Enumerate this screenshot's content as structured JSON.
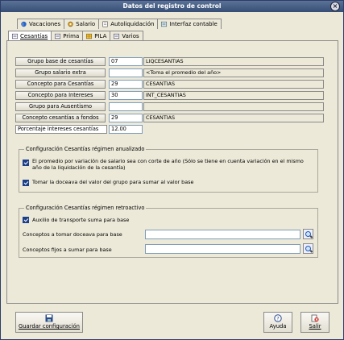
{
  "window": {
    "title": "Datos del registro de control"
  },
  "tabs_row1": [
    {
      "label": "Vacaciones",
      "icon": "vacation-icon",
      "underline": "V"
    },
    {
      "label": "Salario",
      "icon": "gear-icon",
      "underline": "S"
    },
    {
      "label": "Autoliquidación",
      "icon": "document-icon",
      "underline": "A"
    },
    {
      "label": "Interfaz contable",
      "icon": "ledger-icon",
      "underline": ""
    }
  ],
  "tabs_row2": [
    {
      "label": "Cesantías",
      "icon": "list-icon",
      "active": true
    },
    {
      "label": "Prima",
      "icon": "list-icon"
    },
    {
      "label": "PILA",
      "icon": "grid-icon"
    },
    {
      "label": "Varios",
      "icon": "list-icon"
    }
  ],
  "fields": [
    {
      "label": "Grupo base de cesantías",
      "code": "07",
      "desc": "LIQCESANTIAS"
    },
    {
      "label": "Grupo salario extra",
      "code": "",
      "desc": "<Toma el promedio del año>"
    },
    {
      "label": "Concepto para Cesantías",
      "code": "29",
      "desc": "CESANTIAS"
    },
    {
      "label": "Concepto para Intereses",
      "code": "30",
      "desc": "INT_CESANTIAS"
    },
    {
      "label": "Grupo para Ausentismo",
      "code": "",
      "desc": ""
    },
    {
      "label": "Concepto cesantías a fondos",
      "code": "29",
      "desc": "CESANTIAS"
    },
    {
      "label": "Porcentaje intereses cesantías",
      "code": "12.00",
      "desc": null
    }
  ],
  "group_anual": {
    "title": "Configuración Cesantías régimen anualizado",
    "opt1": "El promedio por variación de salario sea con corte de año (Sólo se tiene en cuenta variación en el mismo año de la liquidación de la cesantía)",
    "opt2": "Tomar la doceava del valor del grupo para sumar al valor base"
  },
  "group_retro": {
    "title": "Configuración Cesantías régimen retroactivo",
    "opt1": "Auxilio de transporte suma para base",
    "field1_label": "Conceptos a tomar doceava para base",
    "field2_label": "Conceptos fijos a sumar para base"
  },
  "buttons": {
    "save": "Guardar configuración",
    "help": "Ayuda",
    "exit": "Salir"
  }
}
